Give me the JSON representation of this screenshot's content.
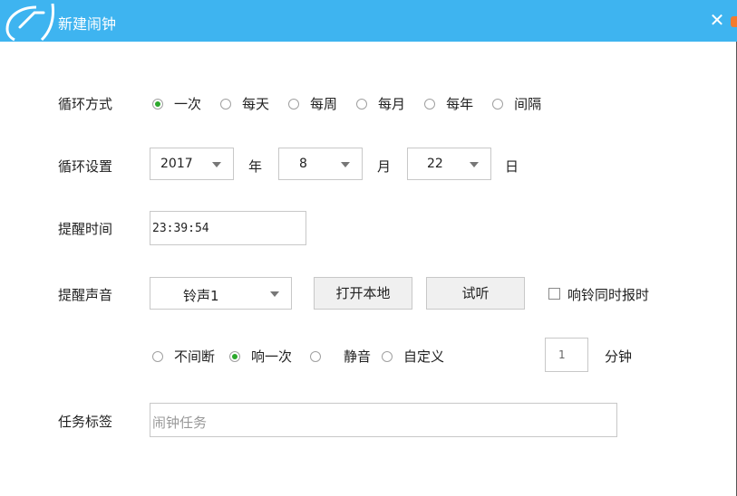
{
  "window": {
    "title": "新建闹钟",
    "close_label": "✕"
  },
  "cycle_mode": {
    "label": "循环方式",
    "options": [
      "一次",
      "每天",
      "每周",
      "每月",
      "每年",
      "间隔"
    ],
    "selected": "一次"
  },
  "cycle_settings": {
    "label": "循环设置",
    "year": "2017",
    "year_unit": "年",
    "month": "8",
    "month_unit": "月",
    "day": "22",
    "day_unit": "日"
  },
  "reminder_time": {
    "label": "提醒时间",
    "value": "23:39:54"
  },
  "reminder_sound": {
    "label": "提醒声音",
    "ringtone": "铃声1",
    "open_local_label": "打开本地",
    "preview_label": "试听",
    "announce_label": "响铃同时报时",
    "modes": [
      "不间断",
      "响一次",
      "静音",
      "自定义"
    ],
    "selected_mode": "响一次",
    "minutes_value": "1",
    "minutes_unit": "分钟"
  },
  "task_tag": {
    "label": "任务标签",
    "placeholder": "闹钟任务"
  },
  "colors": {
    "titlebar": "#3eb4f0",
    "radio_checked": "#2ca82c",
    "accent_edge": "#f27a2e"
  }
}
